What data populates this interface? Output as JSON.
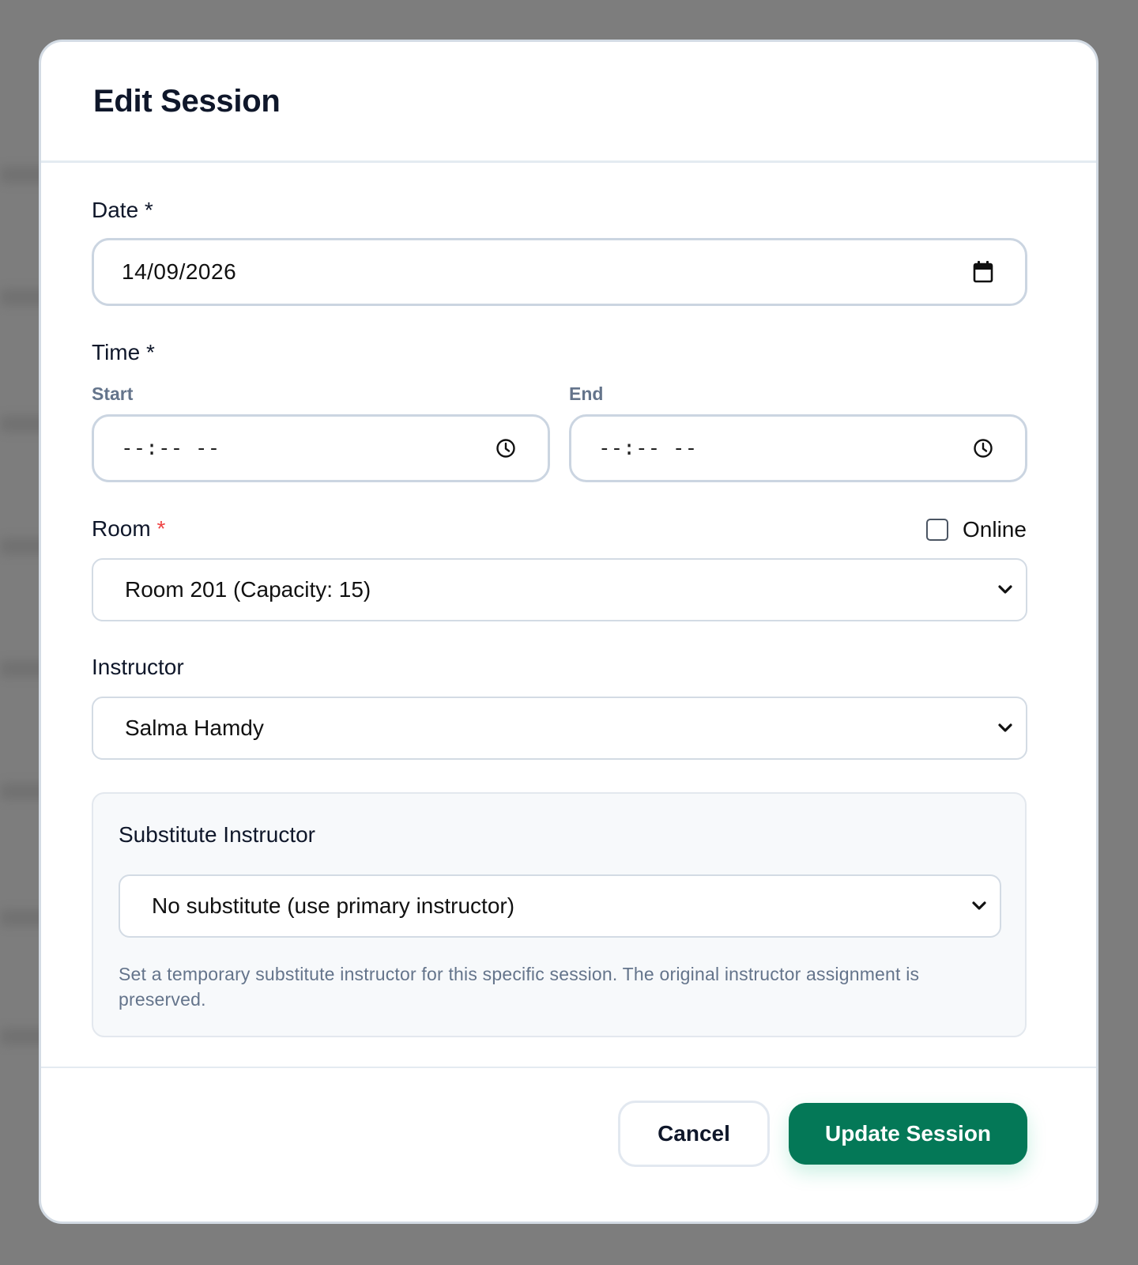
{
  "modal": {
    "title": "Edit Session"
  },
  "date": {
    "label": "Date *",
    "value": "14/09/2026",
    "icon": "calendar-icon"
  },
  "time": {
    "label": "Time *",
    "start_label": "Start",
    "start_value": "--:-- --",
    "end_label": "End",
    "end_value": "--:-- --",
    "icon": "clock-icon"
  },
  "room": {
    "label": "Room",
    "required_marker": "*",
    "required_color": "#ef4444",
    "selected": "Room 201 (Capacity: 15)",
    "online_label": "Online",
    "online_checked": false
  },
  "instructor": {
    "label": "Instructor",
    "selected": "Salma Hamdy"
  },
  "substitute": {
    "label": "Substitute Instructor",
    "selected": "No substitute (use primary instructor)",
    "help": "Set a temporary substitute instructor for this specific session. The original instructor assignment is preserved."
  },
  "footer": {
    "cancel_label": "Cancel",
    "submit_label": "Update Session",
    "submit_color": "#047857"
  }
}
